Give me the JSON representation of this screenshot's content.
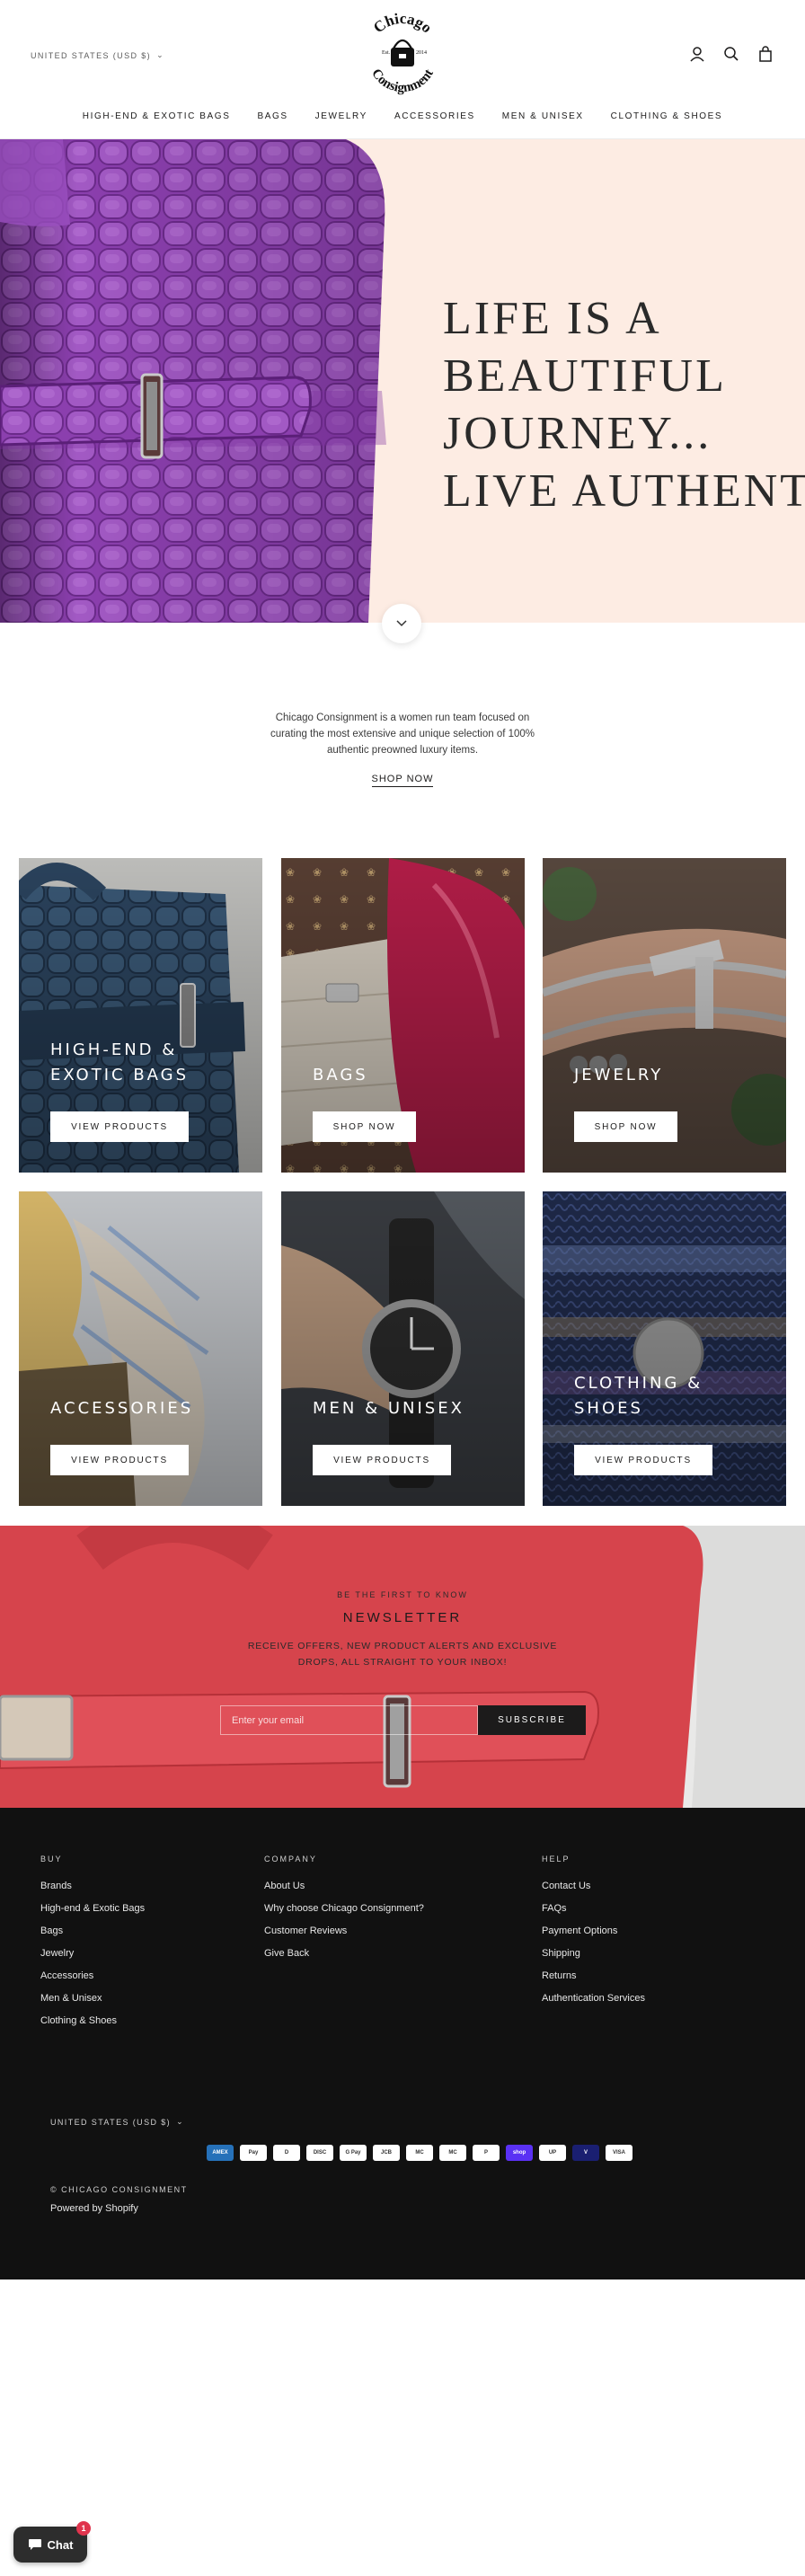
{
  "header": {
    "locale": "UNITED STATES (USD $)",
    "logo_text": "Chicago Consignment",
    "logo_est": "Est.",
    "logo_year": "2014",
    "nav": [
      "HIGH-END & EXOTIC BAGS",
      "BAGS",
      "JEWELRY",
      "ACCESSORIES",
      "MEN & UNISEX",
      "CLOTHING & SHOES"
    ]
  },
  "hero": {
    "lines": [
      "LIFE IS A",
      "BEAUTIFUL",
      "JOURNEY...",
      "LIVE AUTHENTI"
    ]
  },
  "intro": {
    "text": "Chicago Consignment is a women run team focused on curating the most extensive and unique selection of 100% authentic preowned luxury items.",
    "link": "SHOP NOW"
  },
  "collections": [
    {
      "title_lines": [
        "HIGH-END &",
        "EXOTIC BAGS"
      ],
      "button": "VIEW PRODUCTS"
    },
    {
      "title_lines": [
        "BAGS"
      ],
      "button": "SHOP NOW"
    },
    {
      "title_lines": [
        "JEWELRY"
      ],
      "button": "SHOP NOW"
    },
    {
      "title_lines": [
        "ACCESSORIES"
      ],
      "button": "VIEW PRODUCTS"
    },
    {
      "title_lines": [
        "MEN & UNISEX"
      ],
      "button": "VIEW PRODUCTS"
    },
    {
      "title_lines": [
        "CLOTHING &",
        "SHOES"
      ],
      "button": "VIEW PRODUCTS"
    }
  ],
  "newsletter": {
    "kicker": "BE THE FIRST TO KNOW",
    "title": "NEWSLETTER",
    "text": "RECEIVE OFFERS, NEW PRODUCT ALERTS AND EXCLUSIVE DROPS, ALL STRAIGHT TO YOUR INBOX!",
    "placeholder": "Enter your email",
    "button": "SUBSCRIBE"
  },
  "footer": {
    "buy": {
      "heading": "BUY",
      "links": [
        "Brands",
        "High-end & Exotic Bags",
        "Bags",
        "Jewelry",
        "Accessories",
        "Men & Unisex",
        "Clothing & Shoes"
      ]
    },
    "company": {
      "heading": "COMPANY",
      "links": [
        "About Us",
        "Why choose Chicago Consignment?",
        "Customer Reviews",
        "Give Back"
      ]
    },
    "help": {
      "heading": "HELP",
      "links": [
        "Contact Us",
        "FAQs",
        "Payment Options",
        "Shipping",
        "Returns",
        "Authentication Services"
      ]
    },
    "locale": "UNITED STATES (USD $)",
    "payments": [
      {
        "name": "AMEX",
        "color": "#2671b9"
      },
      {
        "name": "Pay",
        "color": "#ffffff"
      },
      {
        "name": "D",
        "color": "#ffffff"
      },
      {
        "name": "DISC",
        "color": "#ffffff"
      },
      {
        "name": "G Pay",
        "color": "#ffffff"
      },
      {
        "name": "JCB",
        "color": "#ffffff"
      },
      {
        "name": "MC",
        "color": "#ffffff"
      },
      {
        "name": "MC",
        "color": "#ffffff"
      },
      {
        "name": "P",
        "color": "#ffffff"
      },
      {
        "name": "shop",
        "color": "#5a31f4"
      },
      {
        "name": "UP",
        "color": "#ffffff"
      },
      {
        "name": "V",
        "color": "#1a1f71"
      },
      {
        "name": "VISA",
        "color": "#ffffff"
      }
    ],
    "copyright": "© CHICAGO CONSIGNMENT",
    "powered": "Powered by Shopify"
  },
  "chat": {
    "label": "Chat",
    "badge": "1"
  }
}
